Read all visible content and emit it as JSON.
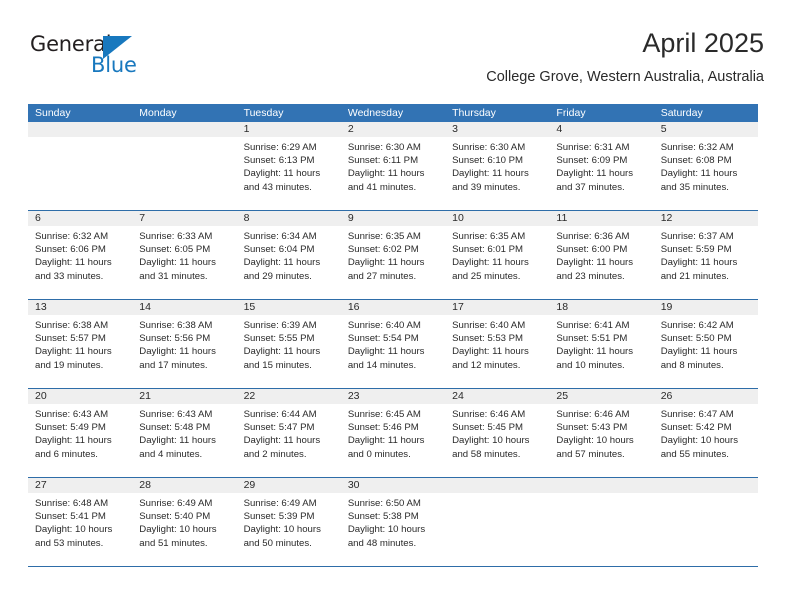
{
  "logo": {
    "word_top": "General",
    "word_bottom": "Blue",
    "triangle_color": "#1878be"
  },
  "header": {
    "title": "April 2025",
    "subtitle": "College Grove, Western Australia, Australia"
  },
  "colors": {
    "header_blue": "#3273b4",
    "row_divider": "#2e6da8",
    "day_band": "#efefef",
    "text": "#2a2a2a"
  },
  "weekdays": [
    "Sunday",
    "Monday",
    "Tuesday",
    "Wednesday",
    "Thursday",
    "Friday",
    "Saturday"
  ],
  "weeks": [
    [
      {
        "day": "",
        "lines": []
      },
      {
        "day": "",
        "lines": []
      },
      {
        "day": "1",
        "lines": [
          "Sunrise: 6:29 AM",
          "Sunset: 6:13 PM",
          "Daylight: 11 hours",
          "and 43 minutes."
        ]
      },
      {
        "day": "2",
        "lines": [
          "Sunrise: 6:30 AM",
          "Sunset: 6:11 PM",
          "Daylight: 11 hours",
          "and 41 minutes."
        ]
      },
      {
        "day": "3",
        "lines": [
          "Sunrise: 6:30 AM",
          "Sunset: 6:10 PM",
          "Daylight: 11 hours",
          "and 39 minutes."
        ]
      },
      {
        "day": "4",
        "lines": [
          "Sunrise: 6:31 AM",
          "Sunset: 6:09 PM",
          "Daylight: 11 hours",
          "and 37 minutes."
        ]
      },
      {
        "day": "5",
        "lines": [
          "Sunrise: 6:32 AM",
          "Sunset: 6:08 PM",
          "Daylight: 11 hours",
          "and 35 minutes."
        ]
      }
    ],
    [
      {
        "day": "6",
        "lines": [
          "Sunrise: 6:32 AM",
          "Sunset: 6:06 PM",
          "Daylight: 11 hours",
          "and 33 minutes."
        ]
      },
      {
        "day": "7",
        "lines": [
          "Sunrise: 6:33 AM",
          "Sunset: 6:05 PM",
          "Daylight: 11 hours",
          "and 31 minutes."
        ]
      },
      {
        "day": "8",
        "lines": [
          "Sunrise: 6:34 AM",
          "Sunset: 6:04 PM",
          "Daylight: 11 hours",
          "and 29 minutes."
        ]
      },
      {
        "day": "9",
        "lines": [
          "Sunrise: 6:35 AM",
          "Sunset: 6:02 PM",
          "Daylight: 11 hours",
          "and 27 minutes."
        ]
      },
      {
        "day": "10",
        "lines": [
          "Sunrise: 6:35 AM",
          "Sunset: 6:01 PM",
          "Daylight: 11 hours",
          "and 25 minutes."
        ]
      },
      {
        "day": "11",
        "lines": [
          "Sunrise: 6:36 AM",
          "Sunset: 6:00 PM",
          "Daylight: 11 hours",
          "and 23 minutes."
        ]
      },
      {
        "day": "12",
        "lines": [
          "Sunrise: 6:37 AM",
          "Sunset: 5:59 PM",
          "Daylight: 11 hours",
          "and 21 minutes."
        ]
      }
    ],
    [
      {
        "day": "13",
        "lines": [
          "Sunrise: 6:38 AM",
          "Sunset: 5:57 PM",
          "Daylight: 11 hours",
          "and 19 minutes."
        ]
      },
      {
        "day": "14",
        "lines": [
          "Sunrise: 6:38 AM",
          "Sunset: 5:56 PM",
          "Daylight: 11 hours",
          "and 17 minutes."
        ]
      },
      {
        "day": "15",
        "lines": [
          "Sunrise: 6:39 AM",
          "Sunset: 5:55 PM",
          "Daylight: 11 hours",
          "and 15 minutes."
        ]
      },
      {
        "day": "16",
        "lines": [
          "Sunrise: 6:40 AM",
          "Sunset: 5:54 PM",
          "Daylight: 11 hours",
          "and 14 minutes."
        ]
      },
      {
        "day": "17",
        "lines": [
          "Sunrise: 6:40 AM",
          "Sunset: 5:53 PM",
          "Daylight: 11 hours",
          "and 12 minutes."
        ]
      },
      {
        "day": "18",
        "lines": [
          "Sunrise: 6:41 AM",
          "Sunset: 5:51 PM",
          "Daylight: 11 hours",
          "and 10 minutes."
        ]
      },
      {
        "day": "19",
        "lines": [
          "Sunrise: 6:42 AM",
          "Sunset: 5:50 PM",
          "Daylight: 11 hours",
          "and 8 minutes."
        ]
      }
    ],
    [
      {
        "day": "20",
        "lines": [
          "Sunrise: 6:43 AM",
          "Sunset: 5:49 PM",
          "Daylight: 11 hours",
          "and 6 minutes."
        ]
      },
      {
        "day": "21",
        "lines": [
          "Sunrise: 6:43 AM",
          "Sunset: 5:48 PM",
          "Daylight: 11 hours",
          "and 4 minutes."
        ]
      },
      {
        "day": "22",
        "lines": [
          "Sunrise: 6:44 AM",
          "Sunset: 5:47 PM",
          "Daylight: 11 hours",
          "and 2 minutes."
        ]
      },
      {
        "day": "23",
        "lines": [
          "Sunrise: 6:45 AM",
          "Sunset: 5:46 PM",
          "Daylight: 11 hours",
          "and 0 minutes."
        ]
      },
      {
        "day": "24",
        "lines": [
          "Sunrise: 6:46 AM",
          "Sunset: 5:45 PM",
          "Daylight: 10 hours",
          "and 58 minutes."
        ]
      },
      {
        "day": "25",
        "lines": [
          "Sunrise: 6:46 AM",
          "Sunset: 5:43 PM",
          "Daylight: 10 hours",
          "and 57 minutes."
        ]
      },
      {
        "day": "26",
        "lines": [
          "Sunrise: 6:47 AM",
          "Sunset: 5:42 PM",
          "Daylight: 10 hours",
          "and 55 minutes."
        ]
      }
    ],
    [
      {
        "day": "27",
        "lines": [
          "Sunrise: 6:48 AM",
          "Sunset: 5:41 PM",
          "Daylight: 10 hours",
          "and 53 minutes."
        ]
      },
      {
        "day": "28",
        "lines": [
          "Sunrise: 6:49 AM",
          "Sunset: 5:40 PM",
          "Daylight: 10 hours",
          "and 51 minutes."
        ]
      },
      {
        "day": "29",
        "lines": [
          "Sunrise: 6:49 AM",
          "Sunset: 5:39 PM",
          "Daylight: 10 hours",
          "and 50 minutes."
        ]
      },
      {
        "day": "30",
        "lines": [
          "Sunrise: 6:50 AM",
          "Sunset: 5:38 PM",
          "Daylight: 10 hours",
          "and 48 minutes."
        ]
      },
      {
        "day": "",
        "lines": []
      },
      {
        "day": "",
        "lines": []
      },
      {
        "day": "",
        "lines": []
      }
    ]
  ]
}
